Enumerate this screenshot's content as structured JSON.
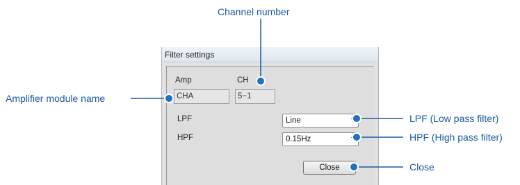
{
  "dialog": {
    "title": "Filter settings",
    "amp_label": "Amp",
    "amp_value": "CHA",
    "ch_label": "CH",
    "ch_value": "5−1",
    "lpf_label": "LPF",
    "lpf_value": "Line",
    "hpf_label": "HPF",
    "hpf_value": "0.15Hz",
    "close_label": "Close"
  },
  "callouts": {
    "channel_number": "Channel number",
    "amplifier_module_name": "Amplifier module name",
    "lpf": "LPF (Low pass filter)",
    "hpf": "HPF (High pass filter)",
    "close": "Close"
  },
  "colors": {
    "callout": "#1b5aa0",
    "marker": "#1f6fc2"
  }
}
